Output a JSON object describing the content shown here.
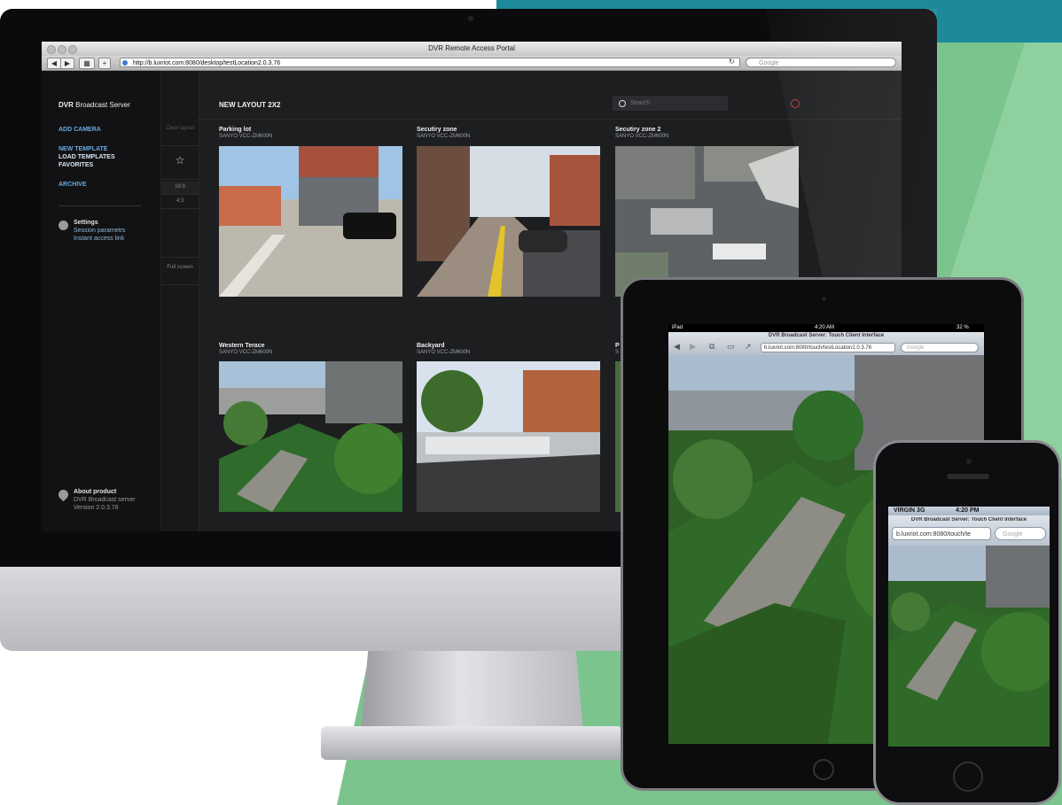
{
  "browser": {
    "window_title": "DVR Remote Access Portal",
    "url": "http://b.luxriot.com:8080/desktop/testLocation2.0.3.76",
    "search_placeholder": "Google"
  },
  "sidebar": {
    "brand_bold": "DVR",
    "brand_rest": " Broadcast Server",
    "links": [
      "ADD CAMERA",
      "NEW TEMPLATE",
      "LOAD TEMPLATES",
      "FAVORITES",
      "ARCHIVE"
    ],
    "settings_title": "Settings",
    "settings_items": [
      "Session parametrs",
      "Instant access link"
    ],
    "about_title": "About product",
    "about_lines": [
      "DVR Broadcast server",
      "Version 2.0.3.76"
    ]
  },
  "layout_column": {
    "clear": "Clear layout",
    "ratio_169": "16:9",
    "ratio_43": "4:3",
    "full_screen": "Full screen"
  },
  "main": {
    "title": "NEW LAYOUT 2X2",
    "search_placeholder": "Search",
    "cameras": [
      {
        "name": "Parking lot",
        "model": "SANYO VCC-ZM600N"
      },
      {
        "name": "Secutiry zone",
        "model": "SANYO VCC-ZM600N"
      },
      {
        "name": "Secutiry zone 2",
        "model": "SANYO VCC-ZM600N"
      },
      {
        "name": "Western Terace",
        "model": "SANYO VCC-ZM600N"
      },
      {
        "name": "Backyard",
        "model": "SANYO VCC-ZM600N"
      },
      {
        "name": "P",
        "model": "S"
      }
    ]
  },
  "ipad": {
    "carrier": "iPad",
    "time": "4:20 AM",
    "battery": "32 %",
    "page_title": "DVR Broadcast Server: Touch Client Interface",
    "url": "b.luxriot.com:8080/touch/testLocation2.0.3.76",
    "search": "Google"
  },
  "iphone": {
    "carrier": "VIRGIN 3G",
    "time": "4:20 PM",
    "page_title": "DVR Broadcast Server: Touch Client Interface",
    "url": "b.luxriot.com:8080/touch/te",
    "search": "Google"
  },
  "colors": {
    "accent_link": "#6aa9e0",
    "teal": "#1c8a98",
    "green": "#7cc48e"
  }
}
